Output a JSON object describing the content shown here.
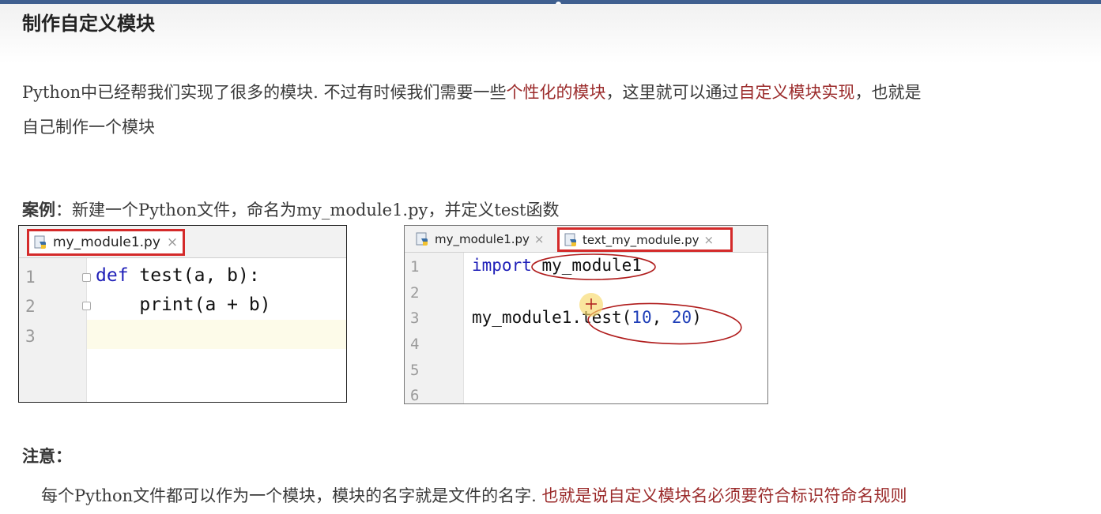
{
  "page": {
    "title": "制作自定义模块",
    "intro": {
      "part1": "Python中已经帮我们实现了很多的模块. 不过有时候我们需要一些",
      "highlight1": "个性化的模块",
      "part2": "，这里就可以通过",
      "highlight2": "自定义模块实现",
      "part3": "，也就是",
      "line2": "自己制作一个模块"
    },
    "case": {
      "label": "案例",
      "text": "：新建一个Python文件，命名为my_module1.py，并定义test函数"
    },
    "note": {
      "label": "注意：",
      "text": "每个Python文件都可以作为一个模块，模块的名字就是文件的名字.",
      "highlight": "也就是说自定义模块名必须要符合标识符命名规则"
    }
  },
  "editor1": {
    "tab": {
      "label": "my_module1.py",
      "close": "×"
    },
    "line_numbers": [
      "1",
      "2",
      "3"
    ],
    "code": {
      "line1_kw": "def",
      "line1_rest": " test(a, b):",
      "line2": "    print(a + b)"
    }
  },
  "editor2": {
    "tabs": [
      {
        "label": "my_module1.py",
        "close": "×"
      },
      {
        "label": "text_my_module.py",
        "close": "×"
      }
    ],
    "line_numbers": [
      "1",
      "2",
      "3",
      "4",
      "5",
      "6"
    ],
    "code": {
      "line1_kw": "import",
      "line1_rest": " my_module1",
      "line3_pre": "my_module1.test(",
      "line3_n1": "10",
      "line3_sep": ", ",
      "line3_n2": "20",
      "line3_post": ")"
    }
  },
  "colors": {
    "highlight_text": "#9b2b2b",
    "tab_box": "#d42a2a",
    "annotation": "#b01c1c",
    "keyword": "#1f1fb8"
  }
}
